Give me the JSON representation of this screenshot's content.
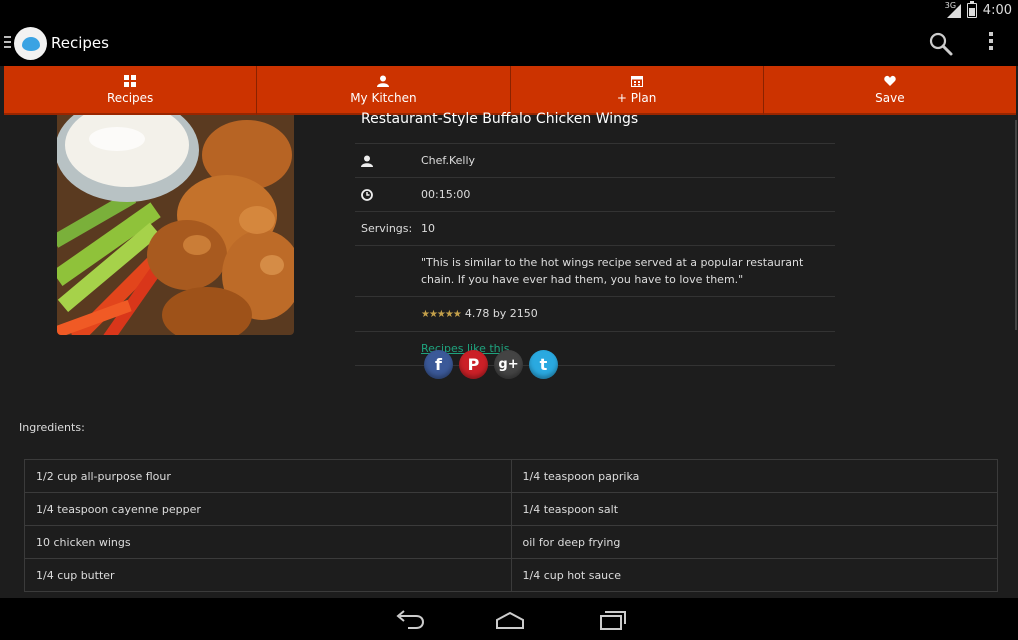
{
  "status": {
    "time": "4:00",
    "network": "3G"
  },
  "app": {
    "title": "Recipes"
  },
  "tabs": [
    {
      "label": "Recipes",
      "icon": "grid-icon"
    },
    {
      "label": "My Kitchen",
      "icon": "person-icon"
    },
    {
      "label": "+ Plan",
      "icon": "calendar-icon"
    },
    {
      "label": "Save",
      "icon": "heart-icon"
    }
  ],
  "recipe": {
    "title": "Restaurant-Style Buffalo Chicken Wings",
    "author": "Chef.Kelly",
    "time": "00:15:00",
    "servings_label": "Servings:",
    "servings": "10",
    "description": "\"This is similar to the hot wings recipe served at a popular restaurant chain. If you have ever had them, you have to love them.\"",
    "rating": "4.78 by 2150",
    "stars": "★★★★★",
    "recipes_like": "Recipes like this"
  },
  "social": [
    {
      "name": "facebook",
      "glyph": "f",
      "color": "#3b5998"
    },
    {
      "name": "pinterest",
      "glyph": "P",
      "color": "#cb2027"
    },
    {
      "name": "google-plus",
      "glyph": "g+",
      "color": "#444444"
    },
    {
      "name": "twitter",
      "glyph": "t",
      "color": "#2aa9e0"
    }
  ],
  "ingredients_label": "Ingredients:",
  "ingredients": [
    [
      "1/2 cup all-purpose flour",
      "1/4 teaspoon paprika"
    ],
    [
      "1/4 teaspoon cayenne pepper",
      "1/4 teaspoon salt"
    ],
    [
      "10 chicken wings",
      "oil for deep frying"
    ],
    [
      "1/4 cup butter",
      "1/4 cup hot sauce"
    ]
  ],
  "colors": {
    "accent": "#cc3300",
    "link": "#1fa37e",
    "background": "#1d1d1d"
  }
}
